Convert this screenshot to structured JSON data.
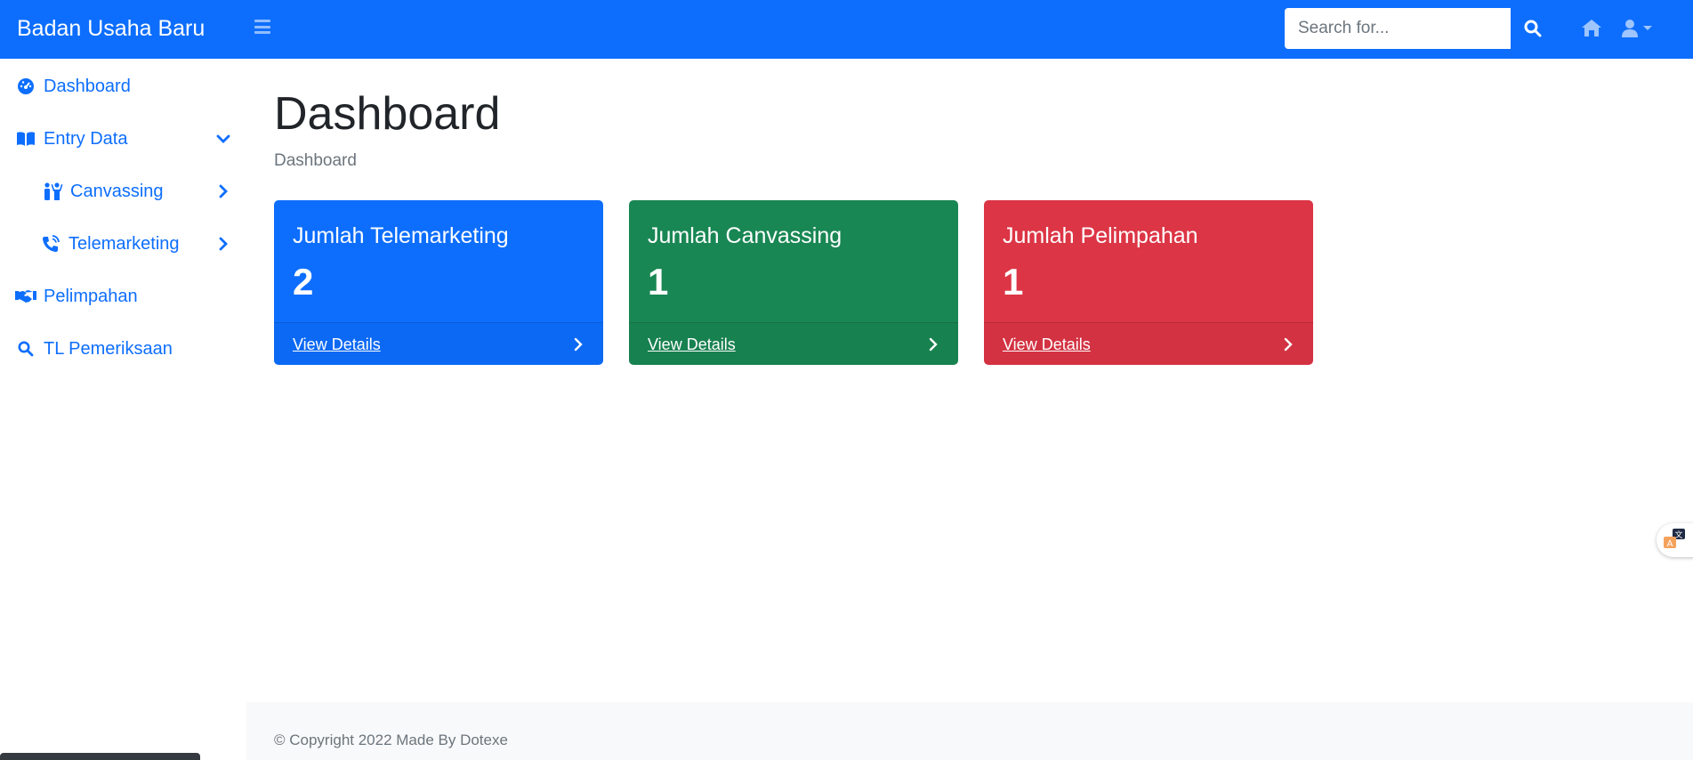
{
  "brand": "Badan Usaha Baru",
  "search": {
    "placeholder": "Search for..."
  },
  "sidebar": {
    "items": [
      {
        "label": "Dashboard",
        "icon": "dashboard-icon"
      },
      {
        "label": "Entry Data",
        "icon": "book-icon",
        "expanded": true
      },
      {
        "label": "Canvassing",
        "icon": "people-icon"
      },
      {
        "label": "Telemarketing",
        "icon": "phone-volume-icon"
      },
      {
        "label": "Pelimpahan",
        "icon": "handshake-icon"
      },
      {
        "label": "TL Pemeriksaan",
        "icon": "search-icon"
      }
    ]
  },
  "page": {
    "title": "Dashboard",
    "breadcrumb": "Dashboard"
  },
  "cards": [
    {
      "title": "Jumlah Telemarketing",
      "value": "2",
      "link": "View Details",
      "color": "#0d6efd"
    },
    {
      "title": "Jumlah Canvassing",
      "value": "1",
      "link": "View Details",
      "color": "#198754"
    },
    {
      "title": "Jumlah Pelimpahan",
      "value": "1",
      "link": "View Details",
      "color": "#dc3545"
    }
  ],
  "footer": {
    "text": "© Copyright 2022 Made By Dotexe"
  },
  "colors": {
    "primary": "#0d6efd",
    "success": "#198754",
    "danger": "#dc3545"
  }
}
